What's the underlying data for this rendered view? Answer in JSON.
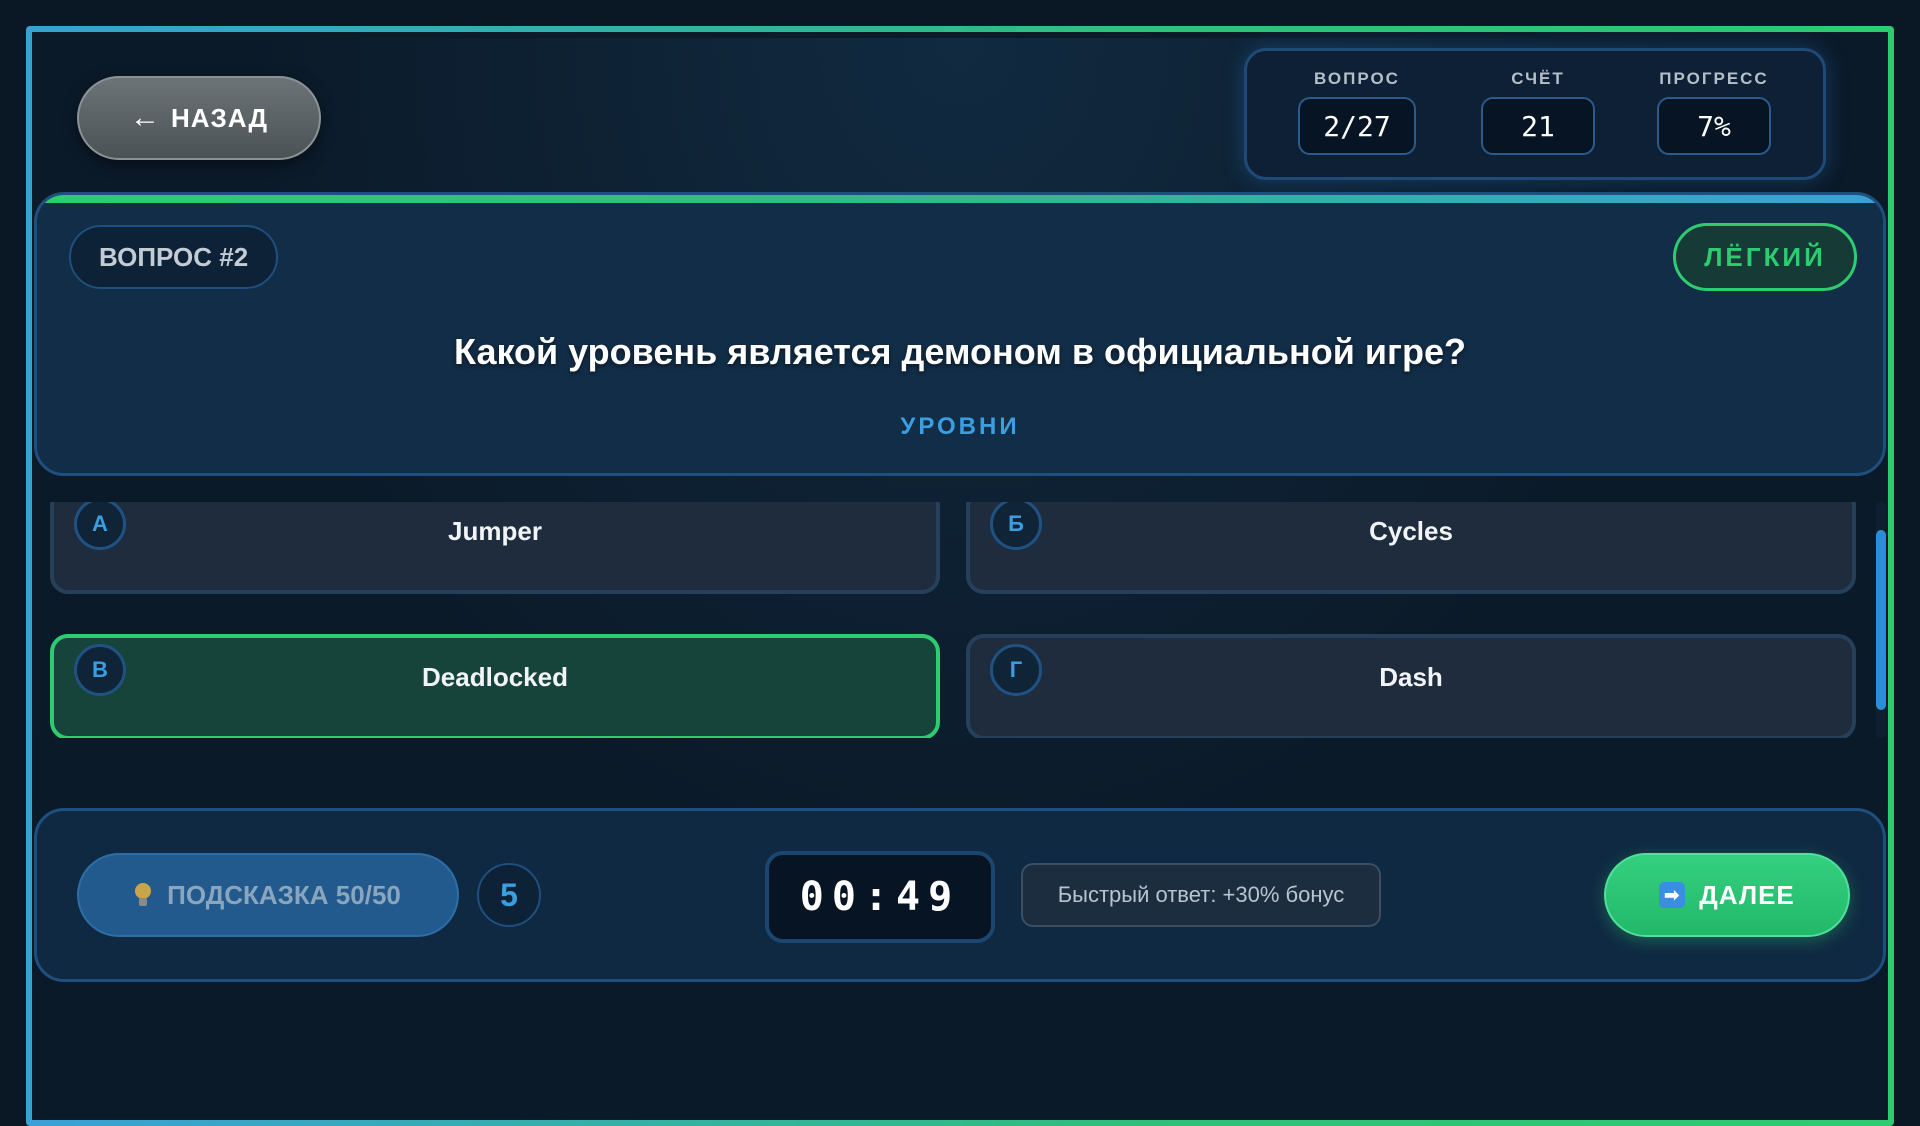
{
  "header": {
    "back_label": "НАЗАД",
    "back_arrow": "←",
    "stats": [
      {
        "label": "ВОПРОС",
        "value": "2/27"
      },
      {
        "label": "СЧЁТ",
        "value": "21"
      },
      {
        "label": "ПРОГРЕСС",
        "value": "7%"
      }
    ]
  },
  "question": {
    "number_label": "ВОПРОС #2",
    "difficulty": "ЛЁГКИЙ",
    "text": "Какой уровень является демоном в официальной игре?",
    "category": "УРОВНИ"
  },
  "answers": [
    {
      "letter": "А",
      "text": "Jumper",
      "selected": false
    },
    {
      "letter": "Б",
      "text": "Cycles",
      "selected": false
    },
    {
      "letter": "В",
      "text": "Deadlocked",
      "selected": true
    },
    {
      "letter": "Г",
      "text": "Dash",
      "selected": false
    }
  ],
  "footer": {
    "hint_label": "ПОДСКАЗКА 50/50",
    "hint_icon": "lightbulb-icon",
    "hint_count": "5",
    "timer": "00:49",
    "bonus_text": "Быстрый ответ: +30% бонус",
    "next_label": "ДАЛЕЕ",
    "next_icon": "arrow-right-icon"
  },
  "colors": {
    "accent_green": "#2ecc71",
    "accent_blue": "#3a9ee0",
    "background": "#0a1826"
  }
}
